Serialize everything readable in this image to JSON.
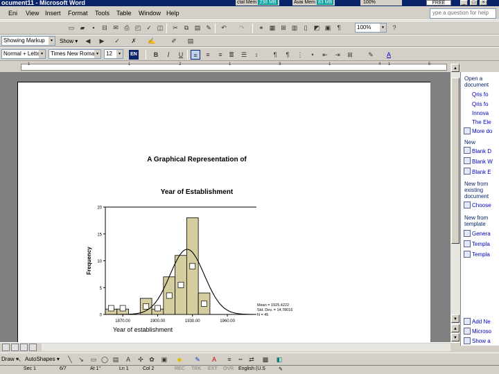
{
  "window": {
    "title": "ocument11 - Microsoft Word",
    "total_mem_label": "ctal Mem",
    "total_mem_value": "238 MB",
    "avail_mem_label": "Avai Mem",
    "avail_mem_value": "83 MB",
    "zoom_value": "100%",
    "free_label": "FREE RAM"
  },
  "menu": {
    "items": [
      "Eni",
      "View",
      "Insert",
      "Format",
      "Tools",
      "Table",
      "Window",
      "Help"
    ],
    "help_placeholder": "ype a question for help"
  },
  "standard_toolbar": {
    "zoom": "100%",
    "zoom_arrow": "▾"
  },
  "reviewing_toolbar": {
    "display_mode": "Showing Markup",
    "show_label": "Show ▾"
  },
  "formatting_toolbar": {
    "style": "Normal + Lette",
    "font": "Times New Roman",
    "size": "12",
    "language_badge": "EN"
  },
  "ruler": {
    "numbers": [
      "1",
      "1",
      "2",
      "1",
      "3",
      "1",
      "4",
      "1",
      "5"
    ]
  },
  "document": {
    "chart_heading_line1": "A Graphical Representation of",
    "chart_heading_line2": "Year of Establishment"
  },
  "chart_data": {
    "type": "bar",
    "subtype": "histogram with normal curve",
    "title": "A Graphical Representation of Year of Establishment",
    "xlabel": "Year of establishment",
    "ylabel": "Frequency",
    "x_tick_labels": [
      "1870.00",
      "1900.00",
      "1930.00",
      "1960.00"
    ],
    "y_tick_labels": [
      "0",
      "5",
      "10",
      "15",
      "20"
    ],
    "ylim": [
      0,
      20
    ],
    "xlim": [
      1855,
      1985
    ],
    "grid": false,
    "bin_width": 10,
    "bins": [
      {
        "start": 1855,
        "end": 1865,
        "value": 1
      },
      {
        "start": 1865,
        "end": 1875,
        "value": 1
      },
      {
        "start": 1875,
        "end": 1885,
        "value": 0
      },
      {
        "start": 1885,
        "end": 1895,
        "value": 3
      },
      {
        "start": 1895,
        "end": 1905,
        "value": 1
      },
      {
        "start": 1905,
        "end": 1915,
        "value": 7
      },
      {
        "start": 1915,
        "end": 1925,
        "value": 11
      },
      {
        "start": 1925,
        "end": 1935,
        "value": 18
      },
      {
        "start": 1935,
        "end": 1945,
        "value": 4
      }
    ],
    "normal_curve": {
      "mean": 1925.4,
      "std": 14.8,
      "n": 45
    },
    "stats_text": [
      "Mean = 1925.4222",
      "Std. Dev. = 14.78016",
      "N = 45"
    ]
  },
  "task_pane": {
    "open_heading": "Open a document",
    "open_items": [
      "Qris fo",
      "Qris fo",
      "Innova",
      "The Ele",
      "More do"
    ],
    "new_heading": "New",
    "new_items": [
      "Blank D",
      "Blank W",
      "Blank E"
    ],
    "existing_heading": "New from existing document",
    "existing_items": [
      "Choose"
    ],
    "template_heading": "New from template",
    "template_items": [
      "Genera",
      "Templa",
      "Templa"
    ],
    "bottom_items": [
      "Add Ne",
      "Microso",
      "Show a"
    ]
  },
  "drawing_toolbar": {
    "draw_label": "Draw ▾",
    "autoshapes_label": "AutoShapes ▾"
  },
  "status_bar": {
    "items": [
      "Sec 1",
      "6/7",
      "At 1\"",
      "Ln 1",
      "Col 2",
      "REC",
      "TRK",
      "EXT",
      "OVR",
      "English (U.S"
    ]
  }
}
